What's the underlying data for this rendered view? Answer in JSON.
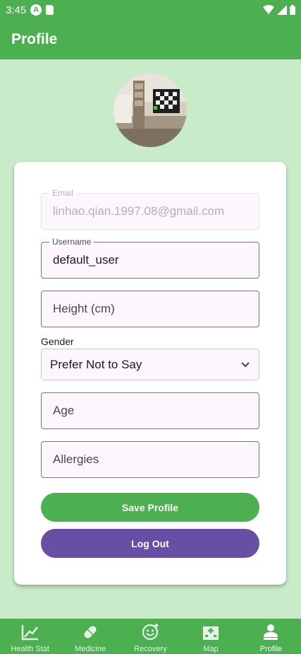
{
  "status_bar": {
    "time": "3:45",
    "notif_icon": "a-circle-icon",
    "sd_icon": "sd-card-icon"
  },
  "app_bar": {
    "title": "Profile"
  },
  "form": {
    "email": {
      "label": "Email",
      "value": "linhao.qian.1997.08@gmail.com"
    },
    "username": {
      "label": "Username",
      "value": "default_user"
    },
    "height": {
      "placeholder": "Height (cm)"
    },
    "gender": {
      "label": "Gender",
      "value": "Prefer Not to Say"
    },
    "age": {
      "placeholder": "Age"
    },
    "allergies": {
      "placeholder": "Allergies"
    }
  },
  "buttons": {
    "save": "Save Profile",
    "logout": "Log Out"
  },
  "bottom_nav": [
    {
      "label": "Health Stat",
      "icon": "chart-line-icon"
    },
    {
      "label": "Medicine",
      "icon": "pill-icon"
    },
    {
      "label": "Recovery",
      "icon": "recovery-face-icon"
    },
    {
      "label": "Map",
      "icon": "hospital-icon"
    },
    {
      "label": "Profile",
      "icon": "person-icon",
      "active": true
    }
  ],
  "colors": {
    "primary": "#4caf50",
    "secondary": "#674fa5",
    "background": "#c8ecc9"
  }
}
